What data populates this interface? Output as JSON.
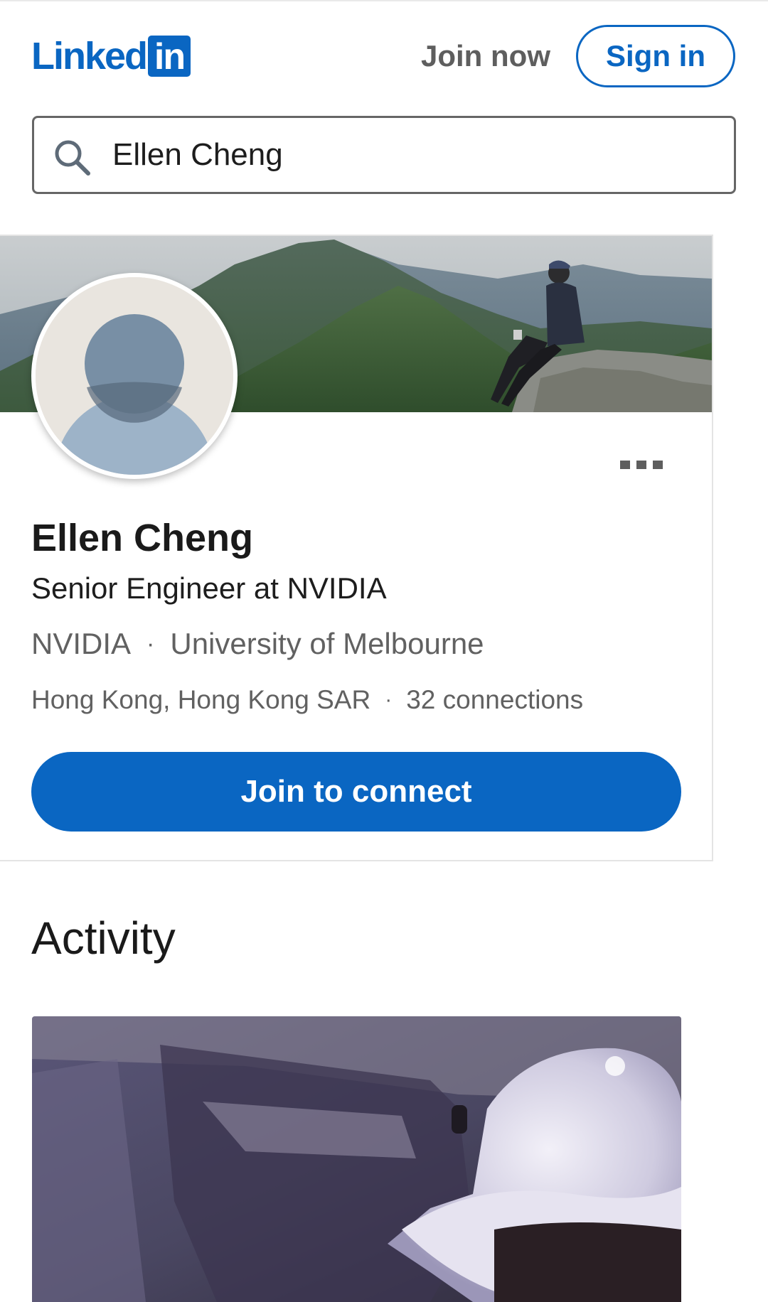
{
  "header": {
    "logo_text": "Linked",
    "logo_badge": "in",
    "join_now_label": "Join now",
    "sign_in_label": "Sign in",
    "brand_color": "#0a66c2"
  },
  "search": {
    "value": "Ellen Cheng",
    "icon": "search-icon"
  },
  "profile": {
    "cover_image": "mountain-landscape-with-person",
    "avatar_icon": "default-person-avatar",
    "more_icon": "more-options-icon",
    "name": "Ellen Cheng",
    "headline": "Senior Engineer at NVIDIA",
    "company": "NVIDIA",
    "school": "University of Melbourne",
    "location": "Hong Kong, Hong Kong SAR",
    "connections": "32 connections",
    "separator": "·",
    "connect_button_label": "Join to connect"
  },
  "activity": {
    "title": "Activity",
    "media": "activity-post-image"
  }
}
